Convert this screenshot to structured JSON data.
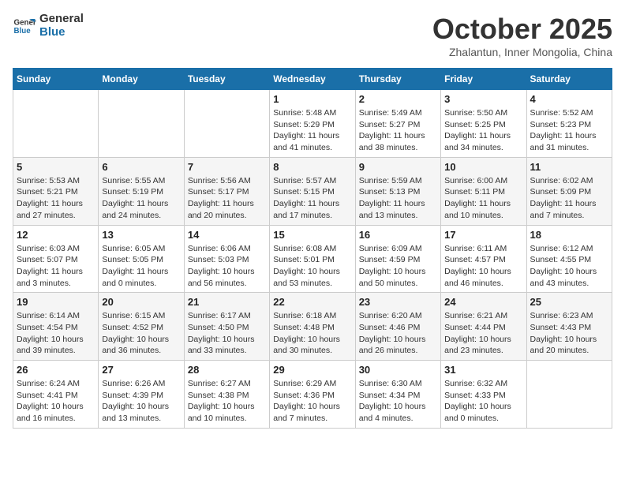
{
  "header": {
    "logo_line1": "General",
    "logo_line2": "Blue",
    "month": "October 2025",
    "location": "Zhalantun, Inner Mongolia, China"
  },
  "weekdays": [
    "Sunday",
    "Monday",
    "Tuesday",
    "Wednesday",
    "Thursday",
    "Friday",
    "Saturday"
  ],
  "weeks": [
    [
      {
        "day": "",
        "info": ""
      },
      {
        "day": "",
        "info": ""
      },
      {
        "day": "",
        "info": ""
      },
      {
        "day": "1",
        "info": "Sunrise: 5:48 AM\nSunset: 5:29 PM\nDaylight: 11 hours\nand 41 minutes."
      },
      {
        "day": "2",
        "info": "Sunrise: 5:49 AM\nSunset: 5:27 PM\nDaylight: 11 hours\nand 38 minutes."
      },
      {
        "day": "3",
        "info": "Sunrise: 5:50 AM\nSunset: 5:25 PM\nDaylight: 11 hours\nand 34 minutes."
      },
      {
        "day": "4",
        "info": "Sunrise: 5:52 AM\nSunset: 5:23 PM\nDaylight: 11 hours\nand 31 minutes."
      }
    ],
    [
      {
        "day": "5",
        "info": "Sunrise: 5:53 AM\nSunset: 5:21 PM\nDaylight: 11 hours\nand 27 minutes."
      },
      {
        "day": "6",
        "info": "Sunrise: 5:55 AM\nSunset: 5:19 PM\nDaylight: 11 hours\nand 24 minutes."
      },
      {
        "day": "7",
        "info": "Sunrise: 5:56 AM\nSunset: 5:17 PM\nDaylight: 11 hours\nand 20 minutes."
      },
      {
        "day": "8",
        "info": "Sunrise: 5:57 AM\nSunset: 5:15 PM\nDaylight: 11 hours\nand 17 minutes."
      },
      {
        "day": "9",
        "info": "Sunrise: 5:59 AM\nSunset: 5:13 PM\nDaylight: 11 hours\nand 13 minutes."
      },
      {
        "day": "10",
        "info": "Sunrise: 6:00 AM\nSunset: 5:11 PM\nDaylight: 11 hours\nand 10 minutes."
      },
      {
        "day": "11",
        "info": "Sunrise: 6:02 AM\nSunset: 5:09 PM\nDaylight: 11 hours\nand 7 minutes."
      }
    ],
    [
      {
        "day": "12",
        "info": "Sunrise: 6:03 AM\nSunset: 5:07 PM\nDaylight: 11 hours\nand 3 minutes."
      },
      {
        "day": "13",
        "info": "Sunrise: 6:05 AM\nSunset: 5:05 PM\nDaylight: 11 hours\nand 0 minutes."
      },
      {
        "day": "14",
        "info": "Sunrise: 6:06 AM\nSunset: 5:03 PM\nDaylight: 10 hours\nand 56 minutes."
      },
      {
        "day": "15",
        "info": "Sunrise: 6:08 AM\nSunset: 5:01 PM\nDaylight: 10 hours\nand 53 minutes."
      },
      {
        "day": "16",
        "info": "Sunrise: 6:09 AM\nSunset: 4:59 PM\nDaylight: 10 hours\nand 50 minutes."
      },
      {
        "day": "17",
        "info": "Sunrise: 6:11 AM\nSunset: 4:57 PM\nDaylight: 10 hours\nand 46 minutes."
      },
      {
        "day": "18",
        "info": "Sunrise: 6:12 AM\nSunset: 4:55 PM\nDaylight: 10 hours\nand 43 minutes."
      }
    ],
    [
      {
        "day": "19",
        "info": "Sunrise: 6:14 AM\nSunset: 4:54 PM\nDaylight: 10 hours\nand 39 minutes."
      },
      {
        "day": "20",
        "info": "Sunrise: 6:15 AM\nSunset: 4:52 PM\nDaylight: 10 hours\nand 36 minutes."
      },
      {
        "day": "21",
        "info": "Sunrise: 6:17 AM\nSunset: 4:50 PM\nDaylight: 10 hours\nand 33 minutes."
      },
      {
        "day": "22",
        "info": "Sunrise: 6:18 AM\nSunset: 4:48 PM\nDaylight: 10 hours\nand 30 minutes."
      },
      {
        "day": "23",
        "info": "Sunrise: 6:20 AM\nSunset: 4:46 PM\nDaylight: 10 hours\nand 26 minutes."
      },
      {
        "day": "24",
        "info": "Sunrise: 6:21 AM\nSunset: 4:44 PM\nDaylight: 10 hours\nand 23 minutes."
      },
      {
        "day": "25",
        "info": "Sunrise: 6:23 AM\nSunset: 4:43 PM\nDaylight: 10 hours\nand 20 minutes."
      }
    ],
    [
      {
        "day": "26",
        "info": "Sunrise: 6:24 AM\nSunset: 4:41 PM\nDaylight: 10 hours\nand 16 minutes."
      },
      {
        "day": "27",
        "info": "Sunrise: 6:26 AM\nSunset: 4:39 PM\nDaylight: 10 hours\nand 13 minutes."
      },
      {
        "day": "28",
        "info": "Sunrise: 6:27 AM\nSunset: 4:38 PM\nDaylight: 10 hours\nand 10 minutes."
      },
      {
        "day": "29",
        "info": "Sunrise: 6:29 AM\nSunset: 4:36 PM\nDaylight: 10 hours\nand 7 minutes."
      },
      {
        "day": "30",
        "info": "Sunrise: 6:30 AM\nSunset: 4:34 PM\nDaylight: 10 hours\nand 4 minutes."
      },
      {
        "day": "31",
        "info": "Sunrise: 6:32 AM\nSunset: 4:33 PM\nDaylight: 10 hours\nand 0 minutes."
      },
      {
        "day": "",
        "info": ""
      }
    ]
  ]
}
